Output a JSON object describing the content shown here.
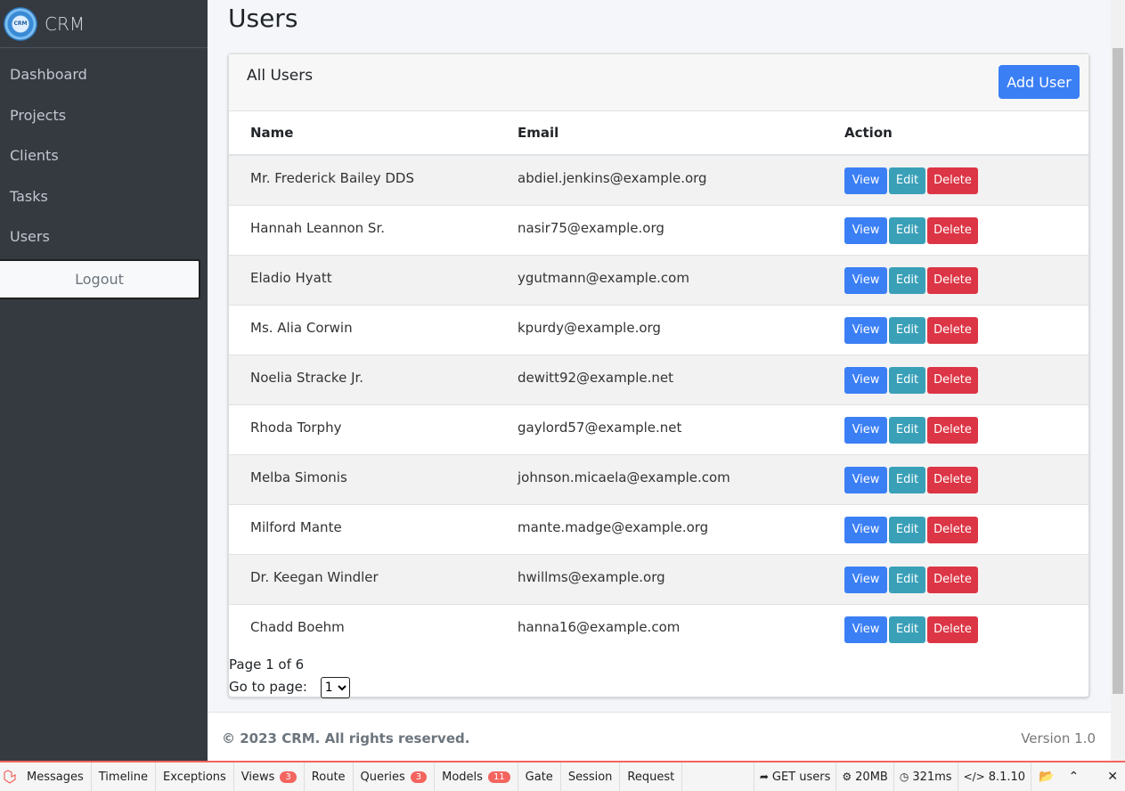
{
  "sidebar": {
    "brand": "CRM",
    "items": [
      {
        "label": "Dashboard"
      },
      {
        "label": "Projects"
      },
      {
        "label": "Clients"
      },
      {
        "label": "Tasks"
      },
      {
        "label": "Users"
      }
    ],
    "logout_label": "Logout"
  },
  "main": {
    "title": "Users",
    "card_title": "All Users",
    "add_button": "Add User",
    "columns": [
      "Name",
      "Email",
      "Action"
    ],
    "rows": [
      {
        "name": "Mr. Frederick Bailey DDS",
        "email": "abdiel.jenkins@example.org"
      },
      {
        "name": "Hannah Leannon Sr.",
        "email": "nasir75@example.org"
      },
      {
        "name": "Eladio Hyatt",
        "email": "ygutmann@example.com"
      },
      {
        "name": "Ms. Alia Corwin",
        "email": "kpurdy@example.org"
      },
      {
        "name": "Noelia Stracke Jr.",
        "email": "dewitt92@example.net"
      },
      {
        "name": "Rhoda Torphy",
        "email": "gaylord57@example.net"
      },
      {
        "name": "Melba Simonis",
        "email": "johnson.micaela@example.com"
      },
      {
        "name": "Milford Mante",
        "email": "mante.madge@example.org"
      },
      {
        "name": "Dr. Keegan Windler",
        "email": "hwillms@example.org"
      },
      {
        "name": "Chadd Boehm",
        "email": "hanna16@example.com"
      }
    ],
    "actions": {
      "view": "View",
      "edit": "Edit",
      "delete": "Delete"
    },
    "pagination": {
      "page_text": "Page 1 of 6",
      "goto_label": "Go to page:",
      "selected_page": "1"
    }
  },
  "footer": {
    "copyright": "© 2023 CRM. All rights reserved.",
    "version": "Version 1.0"
  },
  "debugbar": {
    "tabs": [
      {
        "label": "Messages"
      },
      {
        "label": "Timeline"
      },
      {
        "label": "Exceptions"
      },
      {
        "label": "Views",
        "badge": "3"
      },
      {
        "label": "Route"
      },
      {
        "label": "Queries",
        "badge": "3"
      },
      {
        "label": "Models",
        "badge": "11"
      },
      {
        "label": "Gate"
      },
      {
        "label": "Session"
      },
      {
        "label": "Request"
      }
    ],
    "request": "GET users",
    "memory": "20MB",
    "time": "321ms",
    "php_version": "8.1.10"
  },
  "colors": {
    "primary": "#3b7ff5",
    "info": "#3aa0b8",
    "danger": "#dc3545",
    "sidebar": "#343a40",
    "debug_accent": "#f4645f"
  }
}
